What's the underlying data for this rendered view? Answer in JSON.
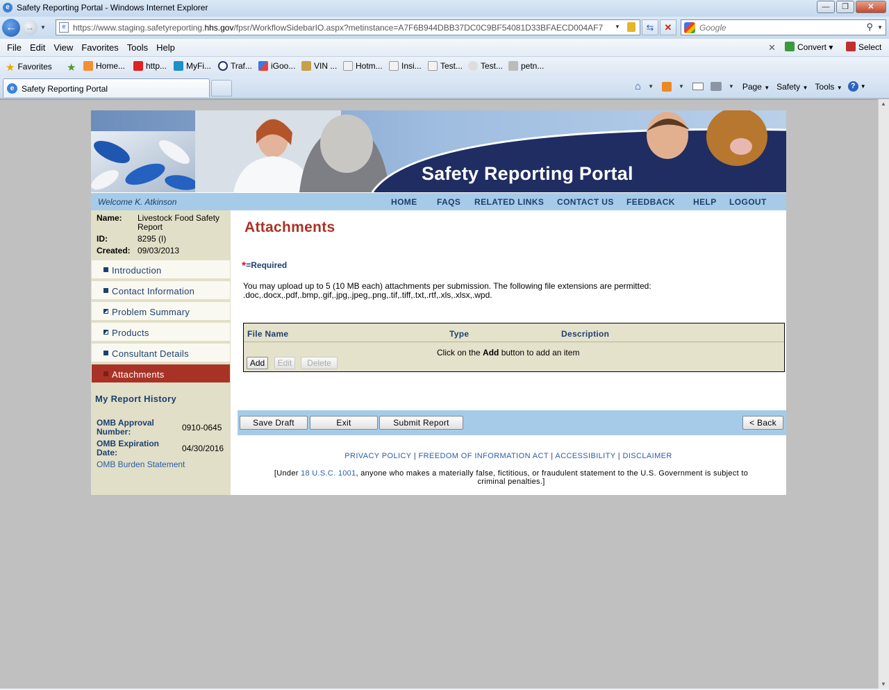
{
  "window": {
    "title": "Safety Reporting Portal - Windows Internet Explorer"
  },
  "address": {
    "url_prefix": "https://www.staging.safetyreporting.",
    "url_domain": "hhs.gov",
    "url_suffix": "/fpsr/WorkflowSidebarIO.aspx?metinstance=A7F6B944DBB37DC0C9BF54081D33BFAECD004AF7",
    "search_placeholder": "Google"
  },
  "menu": {
    "items": [
      "File",
      "Edit",
      "View",
      "Favorites",
      "Tools",
      "Help"
    ],
    "convert": "Convert",
    "select": "Select"
  },
  "favorites": {
    "label": "Favorites",
    "items": [
      "Home...",
      "http...",
      "MyFi...",
      "Traf...",
      "iGoo...",
      "VIN ...",
      "Hotm...",
      "Insi...",
      "Test...",
      "Test...",
      "petn..."
    ]
  },
  "tab": {
    "label": "Safety Reporting Portal"
  },
  "commandbar": {
    "page": "Page",
    "safety": "Safety",
    "tools": "Tools"
  },
  "portal": {
    "banner_title": "Safety Reporting Portal",
    "welcome": "Welcome K. Atkinson",
    "nav": [
      "HOME",
      "FAQS",
      "RELATED LINKS",
      "CONTACT US",
      "FEEDBACK",
      "HELP",
      "LOGOUT"
    ]
  },
  "sidebar": {
    "name_label": "Name:",
    "name_value_1": "Livestock Food Safety",
    "name_value_2": "Report",
    "id_label": "ID:",
    "id_value": "8295 (I)",
    "created_label": "Created:",
    "created_value": "09/03/2013",
    "items": [
      {
        "label": "Introduction"
      },
      {
        "label": "Contact Information"
      },
      {
        "label": "Problem Summary"
      },
      {
        "label": "Products"
      },
      {
        "label": "Consultant Details"
      },
      {
        "label": "Attachments"
      }
    ],
    "report_history": "My Report History",
    "omb_approval_label_1": "OMB Approval",
    "omb_approval_label_2": "Number:",
    "omb_approval_value": "0910-0645",
    "omb_expiration_label_1": "OMB Expiration",
    "omb_expiration_label_2": "Date:",
    "omb_expiration_value": "04/30/2016",
    "omb_burden": "OMB Burden Statement"
  },
  "main": {
    "heading": "Attachments",
    "required_marker": "*",
    "required_text": "=Required",
    "upload_line_1": "You may upload up to 5 (10 MB each) attachments per submission. The following file extensions are permitted:",
    "upload_line_2": ".doc,.docx,.pdf,.bmp,.gif,.jpg,.jpeg,.png,.tif,.tiff,.txt,.rtf,.xls,.xlsx,.wpd.",
    "table": {
      "columns": [
        "File Name",
        "Type",
        "Description"
      ],
      "empty_prefix": "Click on the ",
      "empty_bold": "Add",
      "empty_suffix": " button to add an item",
      "add": "Add",
      "edit": "Edit",
      "delete": "Delete"
    },
    "actions": {
      "save_draft": "Save Draft",
      "exit": "Exit",
      "submit": "Submit Report",
      "back": "< Back"
    },
    "footer": {
      "privacy": "PRIVACY POLICY",
      "foia": "FREEDOM OF INFORMATION ACT",
      "accessibility": "ACCESSIBILITY",
      "disclaimer": "DISCLAIMER",
      "separator": "|",
      "note_prefix": "[Under ",
      "note_link": "18 U.S.C. 1001",
      "note_suffix": ", anyone who makes a materially false, fictitious, or fraudulent statement to the U.S. Government is subject to",
      "note_line_2": "criminal penalties.]"
    }
  }
}
